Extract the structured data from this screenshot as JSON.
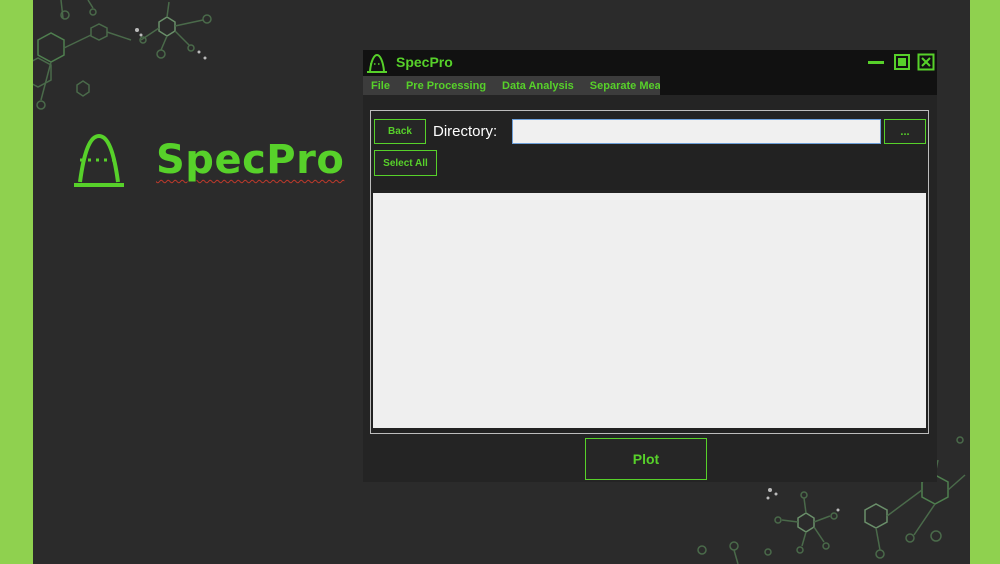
{
  "app": {
    "brand_name": "SpecPro",
    "window_title": "SpecPro"
  },
  "colors": {
    "accent": "#57d12a",
    "side_bar": "#8fd14f",
    "background": "#2b2b2b"
  },
  "icons": {
    "brand": "specpro-logo-icon",
    "minimize": "minimize-icon",
    "maximize": "maximize-icon",
    "close": "close-icon"
  },
  "menu": {
    "items": [
      "File",
      "Pre Processing",
      "Data Analysis",
      "Separate Measures"
    ]
  },
  "toolbar": {
    "back_label": "Back",
    "directory_label": "Directory:",
    "directory_value": "",
    "browse_label": "...",
    "select_all_label": "Select All"
  },
  "actions": {
    "plot_label": "Plot"
  }
}
